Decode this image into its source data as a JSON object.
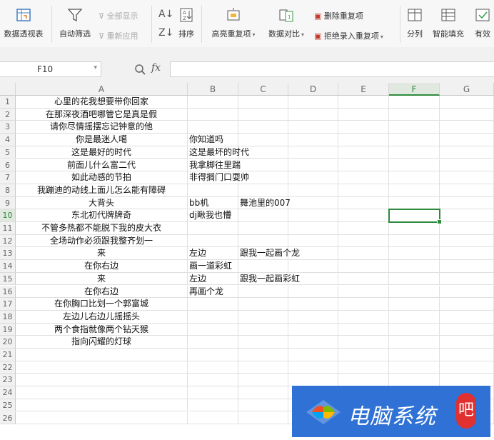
{
  "ribbon": {
    "pivot_table": "数据透视表",
    "auto_filter": "自动筛选",
    "show_all": "全部显示",
    "reapply": "重新应用",
    "sort": "排序",
    "highlight_duplicates": "高亮重复项",
    "data_compare": "数据对比",
    "delete_duplicates": "删除重复项",
    "reject_duplicate_entry": "拒绝录入重复项",
    "split_column": "分列",
    "smart_fill": "智能填充",
    "valid": "有效"
  },
  "formula_bar": {
    "name_box": "F10",
    "fx": "fx",
    "value": ""
  },
  "columns": [
    "A",
    "B",
    "C",
    "D",
    "E",
    "F",
    "G"
  ],
  "selected_cell": "F10",
  "rows": [
    {
      "n": "1",
      "a": "心里的花我想要带你回家",
      "b": "",
      "c": ""
    },
    {
      "n": "2",
      "a": "在那深夜酒吧哪管它是真是假",
      "b": "",
      "c": ""
    },
    {
      "n": "3",
      "a": "请你尽情摇摆忘记钟意的他",
      "b": "",
      "c": ""
    },
    {
      "n": "4",
      "a": "你是最迷人噶",
      "b": "你知道吗",
      "c": ""
    },
    {
      "n": "5",
      "a": "这是最好的时代",
      "b": "这是最坏的时代",
      "c": ""
    },
    {
      "n": "6",
      "a": "前面儿什么富二代",
      "b": "我拿脚往里踹",
      "c": ""
    },
    {
      "n": "7",
      "a": "如此动感的节拍",
      "b": "非得搁门口耍帅",
      "c": ""
    },
    {
      "n": "8",
      "a": "我蹦迪的动线上面儿怎么能有障碍",
      "b": "",
      "c": ""
    },
    {
      "n": "9",
      "a": "大背头",
      "b": "bb机",
      "c": "舞池里的007"
    },
    {
      "n": "10",
      "a": "东北初代牌牌奇",
      "b": "dj瞅我也懵",
      "c": ""
    },
    {
      "n": "11",
      "a": "不管多热都不能脱下我的皮大衣",
      "b": "",
      "c": ""
    },
    {
      "n": "12",
      "a": "全场动作必须跟我整齐划一",
      "b": "",
      "c": ""
    },
    {
      "n": "13",
      "a": "来",
      "b": "左边",
      "c": "跟我一起画个龙"
    },
    {
      "n": "14",
      "a": "在你右边",
      "b": "画一道彩虹",
      "c": ""
    },
    {
      "n": "15",
      "a": "来",
      "b": "左边",
      "c": "跟我一起画彩虹"
    },
    {
      "n": "16",
      "a": "在你右边",
      "b": "再画个龙",
      "c": ""
    },
    {
      "n": "17",
      "a": "在你胸口比划一个郭富城",
      "b": "",
      "c": ""
    },
    {
      "n": "18",
      "a": "左边儿右边儿摇摇头",
      "b": "",
      "c": ""
    },
    {
      "n": "19",
      "a": "两个食指就像两个钻天猴",
      "b": "",
      "c": ""
    },
    {
      "n": "20",
      "a": "指向闪耀的灯球",
      "b": "",
      "c": ""
    },
    {
      "n": "21",
      "a": "",
      "b": "",
      "c": ""
    },
    {
      "n": "22",
      "a": "",
      "b": "",
      "c": ""
    },
    {
      "n": "23",
      "a": "",
      "b": "",
      "c": ""
    },
    {
      "n": "24",
      "a": "",
      "b": "",
      "c": ""
    },
    {
      "n": "25",
      "a": "",
      "b": "",
      "c": ""
    },
    {
      "n": "26",
      "a": "",
      "b": "",
      "c": ""
    }
  ],
  "watermark": {
    "text": "电脑系统",
    "badge": "吧",
    "color": "#2f71d4"
  }
}
